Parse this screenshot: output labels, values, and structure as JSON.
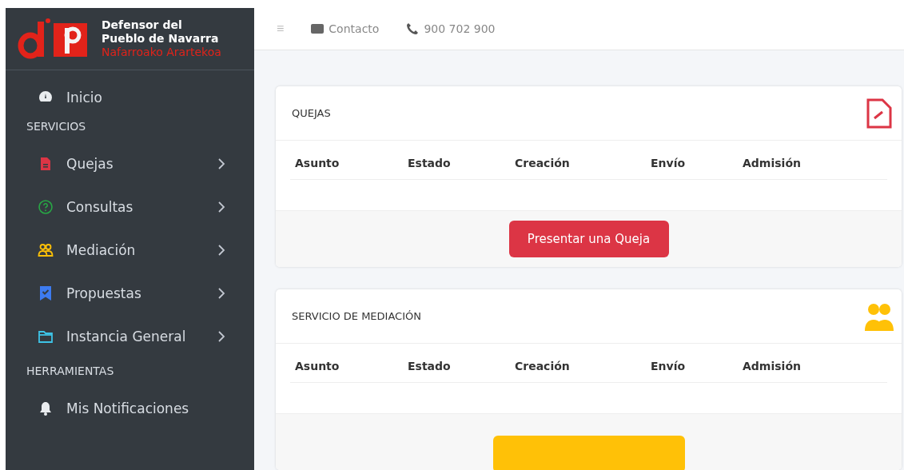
{
  "brand": {
    "line1": "Defensor del",
    "line2": "Pueblo de Navarra",
    "line3": "Nafarroako Arartekoa"
  },
  "sidebar": {
    "items": [
      {
        "kind": "gauge",
        "label": "Inicio",
        "expandable": false,
        "color": "#e9ecef"
      },
      {
        "kind": "header",
        "label": "SERVICIOS"
      },
      {
        "kind": "document",
        "label": "Quejas",
        "expandable": true,
        "color": "#dc3545"
      },
      {
        "kind": "question",
        "label": "Consultas",
        "expandable": true,
        "color": "#28a745"
      },
      {
        "kind": "people",
        "label": "Mediación",
        "expandable": true,
        "color": "#ffc107"
      },
      {
        "kind": "bookmark",
        "label": "Propuestas",
        "expandable": true,
        "color": "#3d7bf0"
      },
      {
        "kind": "folder",
        "label": "Instancia General",
        "expandable": true,
        "color": "#3ec3e6"
      },
      {
        "kind": "header",
        "label": "HERRAMIENTAS"
      },
      {
        "kind": "bell",
        "label": "Mis Notificaciones",
        "expandable": false,
        "color": "#e9ecef"
      }
    ]
  },
  "topbar": {
    "menu": "≡",
    "contact": "Contacto",
    "phone": "900 702 900"
  },
  "cards": [
    {
      "title": "QUEJAS",
      "kind": "document",
      "color": "#dc3545",
      "columns": [
        "Asunto",
        "Estado",
        "Creación",
        "Envío",
        "Admisión"
      ],
      "button": "Presentar una Queja"
    },
    {
      "title": "SERVICIO DE MEDIACIÓN",
      "kind": "people",
      "color": "#ffc107",
      "columns": [
        "Asunto",
        "Estado",
        "Creación",
        "Envío",
        "Admisión"
      ]
    }
  ]
}
